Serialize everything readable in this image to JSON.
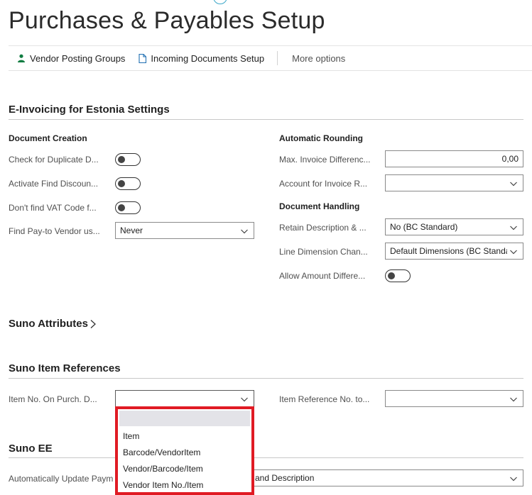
{
  "page": {
    "title": "Purchases & Payables Setup"
  },
  "actions": {
    "vendor_posting_groups": "Vendor Posting Groups",
    "incoming_documents_setup": "Incoming Documents Setup",
    "more_options": "More options"
  },
  "einvoicing": {
    "title": "E-Invoicing for Estonia Settings",
    "document_creation": {
      "title": "Document Creation",
      "check_duplicate": "Check for Duplicate D...",
      "activate_find_discount": "Activate Find Discoun...",
      "dont_find_vat": "Don't find VAT Code f...",
      "find_payto": "Find Pay-to Vendor us...",
      "find_payto_value": "Never"
    },
    "automatic_rounding": {
      "title": "Automatic Rounding",
      "max_invoice_diff": "Max. Invoice Differenc...",
      "max_invoice_diff_value": "0,00",
      "account_invoice": "Account for Invoice R...",
      "account_invoice_value": ""
    },
    "document_handling": {
      "title": "Document Handling",
      "retain_description": "Retain Description & ...",
      "retain_description_value": "No (BC Standard)",
      "line_dimension": "Line Dimension Chan...",
      "line_dimension_value": "Default Dimensions (BC Standa",
      "allow_amount_diff": "Allow Amount Differe..."
    }
  },
  "suno_attributes": {
    "title": "Suno Attributes"
  },
  "suno_item_references": {
    "title": "Suno Item References",
    "item_no_label": "Item No. On Purch. D...",
    "item_no_value": "",
    "item_ref_label": "Item Reference No. to...",
    "item_ref_value": ""
  },
  "dropdown": {
    "items": [
      "Item",
      "Barcode/VendorItem",
      "Vendor/Barcode/Item",
      "Vendor Item No./Item"
    ]
  },
  "suno_ee": {
    "title": "Suno EE",
    "auto_update_label": "Automatically Update Paym",
    "auto_update_value": "and Description"
  },
  "colors": {
    "accent": "#3ba7c9",
    "highlight": "#e01b24",
    "vendor_icon": "#107c41"
  }
}
